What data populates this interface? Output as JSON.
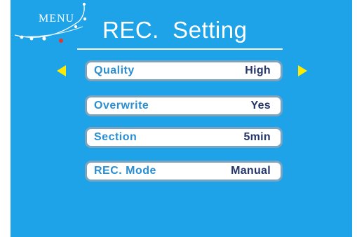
{
  "menu": {
    "logo_text": "MENU",
    "logo_icon": "beaded-arc-icon"
  },
  "title": "REC.  Setting",
  "nav": {
    "left_arrow_icon": "triangle-left-icon",
    "right_arrow_icon": "triangle-right-icon"
  },
  "settings": [
    {
      "label": "Quality",
      "value": "High",
      "selected": true
    },
    {
      "label": "Overwrite",
      "value": "Yes",
      "selected": false
    },
    {
      "label": "Section",
      "value": "5min",
      "selected": false
    },
    {
      "label": "REC. Mode",
      "value": "Manual",
      "selected": false
    }
  ],
  "colors": {
    "background": "#1ea2e8",
    "arrow": "#ffea00",
    "label": "#2a8fd2",
    "value": "#24366b",
    "row_border": "#7da3bf"
  }
}
